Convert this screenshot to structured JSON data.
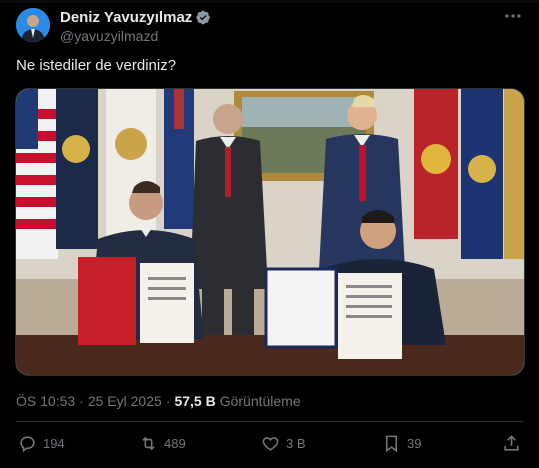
{
  "user": {
    "display_name": "Deniz Yavuzyılmaz",
    "handle": "@yavuzyilmazd",
    "verified_icon": "verified-badge-icon"
  },
  "post": {
    "text": "Ne istediler de verdiniz?"
  },
  "meta": {
    "time": "ÖS 10:53",
    "separator": "·",
    "date": "25 Eyl 2025",
    "views_count": "57,5 B",
    "views_label": "Görüntüleme"
  },
  "actions": {
    "replies": "194",
    "reposts": "489",
    "likes": "3 B",
    "bookmarks": "39"
  },
  "colors": {
    "background": "#000000",
    "text_primary": "#e7e9ea",
    "text_secondary": "#71767b",
    "accent": "#1d9bf0",
    "border": "#2f3336"
  }
}
